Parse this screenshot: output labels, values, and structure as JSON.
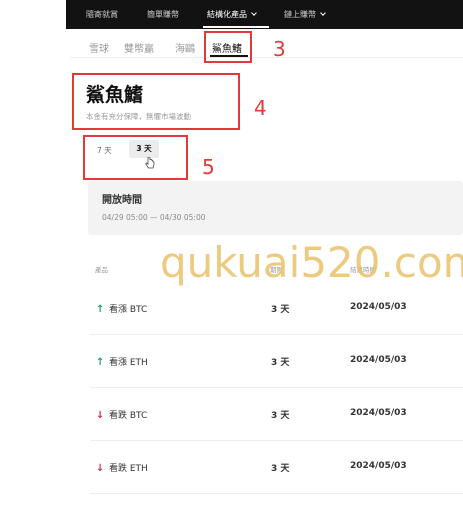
{
  "top_nav": {
    "items": [
      {
        "label": "隨寄就賞"
      },
      {
        "label": "簡單賺幣"
      },
      {
        "label": "結構化產品"
      },
      {
        "label": "鏈上賺幣"
      }
    ]
  },
  "product_tabs": [
    {
      "label": "雪球"
    },
    {
      "label": "雙幣贏"
    },
    {
      "label": "海鷗"
    },
    {
      "label": "鯊魚鰭"
    }
  ],
  "product": {
    "title": "鯊魚鰭",
    "subtitle": "本金有充分保障，無懼市場波動"
  },
  "period_options": [
    "7 天",
    "3 天"
  ],
  "open_time": {
    "title": "開放時間",
    "range": "04/29 05:00 — 04/30 05:00"
  },
  "table": {
    "headers": [
      "產品",
      "期限",
      "結算時間"
    ],
    "rows": [
      {
        "direction": "up",
        "product": "看漲 BTC",
        "term": "3 天",
        "settle": "2024/05/03"
      },
      {
        "direction": "up",
        "product": "看漲 ETH",
        "term": "3 天",
        "settle": "2024/05/03"
      },
      {
        "direction": "down",
        "product": "看跌 BTC",
        "term": "3 天",
        "settle": "2024/05/03"
      },
      {
        "direction": "down",
        "product": "看跌 ETH",
        "term": "3 天",
        "settle": "2024/05/03"
      }
    ]
  },
  "annotations": [
    "3",
    "4",
    "5"
  ],
  "watermark": "qukuai520.com",
  "colors": {
    "up": "#22a16a",
    "down": "#d2334a",
    "annotation": "#e03a3a"
  }
}
